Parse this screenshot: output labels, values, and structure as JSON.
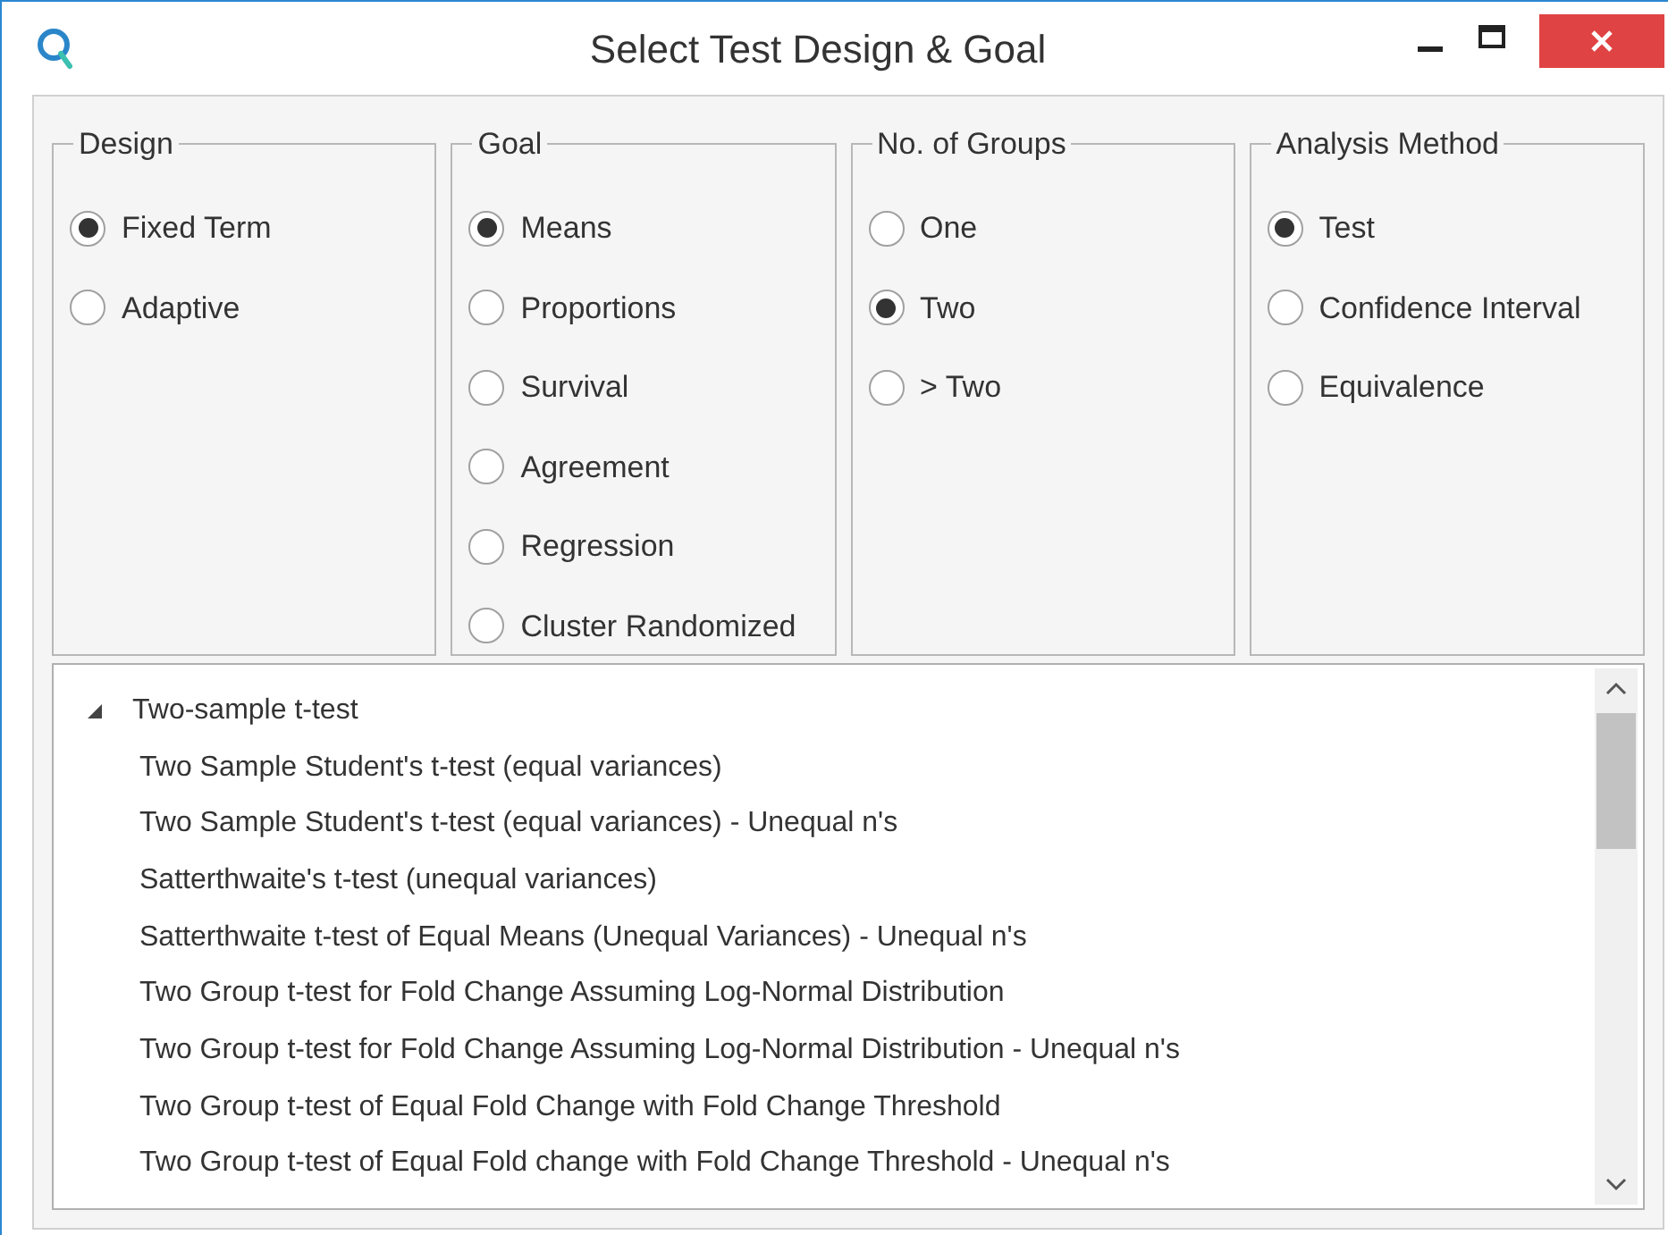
{
  "window": {
    "title": "Select Test Design & Goal"
  },
  "groups": [
    {
      "title": "Design",
      "options": [
        {
          "label": "Fixed Term",
          "selected": true
        },
        {
          "label": "Adaptive",
          "selected": false
        }
      ]
    },
    {
      "title": "Goal",
      "options": [
        {
          "label": "Means",
          "selected": true
        },
        {
          "label": "Proportions",
          "selected": false
        },
        {
          "label": "Survival",
          "selected": false
        },
        {
          "label": "Agreement",
          "selected": false
        },
        {
          "label": "Regression",
          "selected": false
        },
        {
          "label": "Cluster Randomized",
          "selected": false
        }
      ]
    },
    {
      "title": "No. of Groups",
      "options": [
        {
          "label": "One",
          "selected": false
        },
        {
          "label": "Two",
          "selected": true
        },
        {
          "label": "> Two",
          "selected": false
        }
      ]
    },
    {
      "title": "Analysis Method",
      "options": [
        {
          "label": "Test",
          "selected": true
        },
        {
          "label": "Confidence Interval",
          "selected": false
        },
        {
          "label": "Equivalence",
          "selected": false
        }
      ]
    }
  ],
  "tree": [
    {
      "label": "Two-sample t-test",
      "expanded": true,
      "children": [
        {
          "label": "Two Sample Student's t-test (equal variances)"
        },
        {
          "label": "Two Sample Student's t-test (equal variances) - Unequal n's"
        },
        {
          "label": "Satterthwaite's t-test (unequal variances)"
        },
        {
          "label": "Satterthwaite t-test of Equal Means (Unequal Variances) - Unequal n's"
        },
        {
          "label": "Two Group t-test for Fold Change Assuming Log-Normal Distribution"
        },
        {
          "label": "Two Group t-test for Fold Change Assuming Log-Normal Distribution - Unequal n's"
        },
        {
          "label": "Two Group t-test of Equal Fold Change with Fold Change Threshold"
        },
        {
          "label": "Two Group t-test of Equal Fold change with Fold Change Threshold - Unequal n's"
        }
      ]
    }
  ]
}
